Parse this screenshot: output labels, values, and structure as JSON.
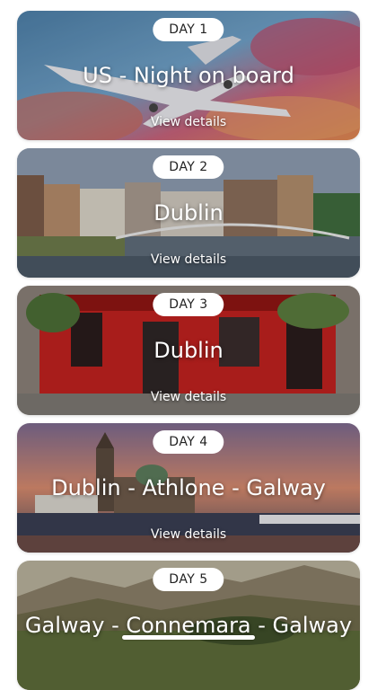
{
  "days": [
    {
      "badge": "DAY 1",
      "title": "US - Night on board",
      "link": "View details"
    },
    {
      "badge": "DAY 2",
      "title": "Dublin",
      "link": "View details"
    },
    {
      "badge": "DAY 3",
      "title": "Dublin",
      "link": "View details"
    },
    {
      "badge": "DAY 4",
      "title": "Dublin - Athlone - Galway",
      "link": "View details"
    },
    {
      "badge": "DAY 5",
      "title": "Galway - Connemara - Galway",
      "link": ""
    }
  ],
  "icons": {
    "day1": "airplane-photo",
    "day2": "city-river-photo",
    "day3": "red-pub-photo",
    "day4": "castle-waterfront-photo",
    "day5": "mountain-landscape-photo"
  }
}
